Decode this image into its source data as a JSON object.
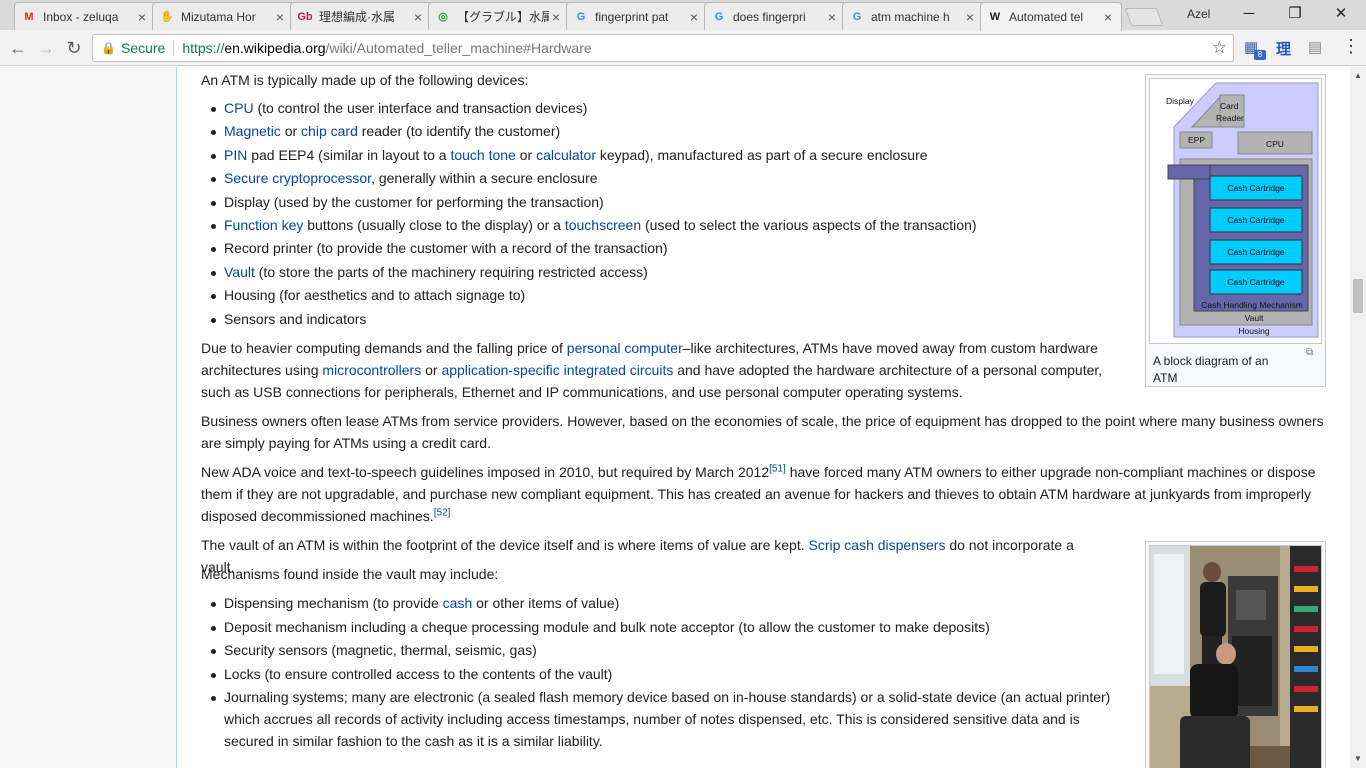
{
  "browser": {
    "tabs": [
      {
        "label": "Inbox - zeluqa",
        "icon": "gmail-icon",
        "glyph": "M",
        "color": "#d93025"
      },
      {
        "label": "Mizutama Hor",
        "icon": "hand-icon",
        "glyph": "✋",
        "color": "#555555"
      },
      {
        "label": "理想編成·水属",
        "icon": "site-icon",
        "glyph": "Gb",
        "color": "#c2185b"
      },
      {
        "label": "【グラブル】水属性",
        "icon": "whatsapp-icon",
        "glyph": "◎",
        "color": "#25a244"
      },
      {
        "label": "fingerprint pat",
        "icon": "google-icon",
        "glyph": "G",
        "color": "#4285f4"
      },
      {
        "label": "does fingerpri",
        "icon": "google-icon",
        "glyph": "G",
        "color": "#4285f4"
      },
      {
        "label": "atm machine h",
        "icon": "google-icon",
        "glyph": "G",
        "color": "#4285f4"
      },
      {
        "label": "Automated tel",
        "icon": "wikipedia-icon",
        "glyph": "W",
        "color": "#222222"
      }
    ],
    "tab_close": "×",
    "profile": "Azel",
    "win": {
      "minimize": "─",
      "restore": "❐",
      "close": "✕"
    },
    "nav": {
      "back": "←",
      "forward": "→",
      "reload": "↻"
    },
    "security": {
      "lock": "🔒",
      "label": "Secure"
    },
    "url": {
      "scheme": "https://",
      "host": "en.wikipedia.org",
      "path": "/wiki/Automated_teller_machine#Hardware"
    },
    "star": "☆",
    "extensions": {
      "ext1": "▦",
      "badge": "8",
      "ext2": "理",
      "ext3": "▤",
      "menu": "⋮"
    }
  },
  "article": {
    "intro": "An ATM is typically made up of the following devices:",
    "devices": [
      {
        "link": "CPU",
        "mid": "",
        "link2": "",
        "rest": " (to control the user interface and transaction devices)"
      },
      {
        "link": "Magnetic",
        "mid": " or ",
        "link2": "chip card",
        "rest": " reader (to identify the customer)"
      },
      {
        "link": "PIN",
        "mid": " pad EEP4 (similar in layout to a ",
        "link2": "touch tone",
        "mid2": " or ",
        "link3": "calculator",
        "rest": " keypad), manufactured as part of a secure enclosure"
      },
      {
        "link": "Secure cryptoprocessor",
        "rest": ", generally within a secure enclosure"
      },
      {
        "text": "Display (used by the customer for performing the transaction)"
      },
      {
        "link": "Function key",
        "mid": " buttons (usually close to the display) or a ",
        "link2": "touchscreen",
        "rest": " (used to select the various aspects of the transaction)"
      },
      {
        "text": "Record printer (to provide the customer with a record of the transaction)"
      },
      {
        "link": "Vault",
        "rest": " (to store the parts of the machinery requiring restricted access)"
      },
      {
        "text": "Housing (for aesthetics and to attach signage to)"
      },
      {
        "text": "Sensors and indicators"
      }
    ],
    "para1": {
      "a": "Due to heavier computing demands and the falling price of ",
      "l1": "personal computer",
      "b": "–like architectures, ATMs have moved away from custom hardware architectures using ",
      "l2": "microcontrollers",
      "c": " or ",
      "l3": "application-specific integrated circuits",
      "d": " and have adopted the hardware architecture of a personal computer, such as USB connections for peripherals, Ethernet and IP communications, and use personal computer operating systems."
    },
    "para2": "Business owners often lease ATMs from service providers. However, based on the economies of scale, the price of equipment has dropped to the point where many business owners are simply paying for ATMs using a credit card.",
    "para3": {
      "a": "New ADA voice and text-to-speech guidelines imposed in 2010, but required by March 2012",
      "ref1": "[51]",
      "b": " have forced many ATM owners to either upgrade non-compliant machines or dispose them if they are not upgradable, and purchase new compliant equipment. This has created an avenue for hackers and thieves to obtain ATM hardware at junkyards from improperly disposed decommissioned machines.",
      "ref2": "[52]"
    },
    "para4": {
      "a": "The vault of an ATM is within the footprint of the device itself and is where items of value are kept. ",
      "l1": "Scrip cash dispensers",
      "b": " do not incorporate a vault."
    },
    "para5": "Mechanisms found inside the vault may include:",
    "mechanisms": [
      {
        "a": "Dispensing mechanism (to provide ",
        "link": "cash",
        "b": " or other items of value)"
      },
      {
        "a": "Deposit mechanism including a cheque processing module and bulk note acceptor (to allow the customer to make deposits)"
      },
      {
        "a": "Security sensors (magnetic, thermal, seismic, gas)"
      },
      {
        "a": "Locks (to ensure controlled access to the contents of the vault)"
      },
      {
        "a": "Journaling systems; many are electronic (a sealed flash memory device based on in-house standards) or a solid-state device (an actual printer) which accrues all records of activity including access timestamps, number of notes dispensed, etc. This is considered sensitive data and is secured in similar fashion to the cash as it is a similar liability."
      }
    ]
  },
  "diagram": {
    "caption": "A block diagram of an ATM",
    "labels": {
      "display": "Display",
      "card": "Card",
      "reader": "Reader",
      "epp": "EPP",
      "cpu": "CPU",
      "cartridge": "Cash Cartridge",
      "mechanism": "Cash Handling Mechanism",
      "vault": "Vault",
      "housing": "Housing"
    },
    "enlarge": "⧉"
  }
}
